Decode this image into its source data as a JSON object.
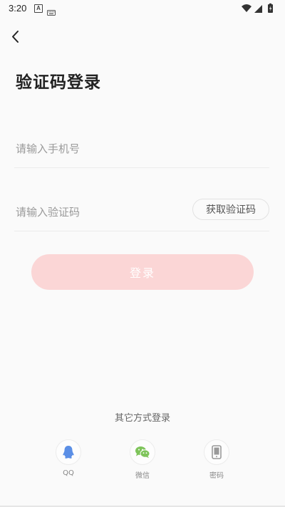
{
  "status_bar": {
    "time": "3:20",
    "icons": [
      "a-icon",
      "keyboard-icon",
      "wifi-icon",
      "signal-icon",
      "battery-icon"
    ]
  },
  "header": {
    "back_icon": "chevron-left-icon",
    "title": "验证码登录"
  },
  "form": {
    "phone_placeholder": "请输入手机号",
    "phone_value": "",
    "code_placeholder": "请输入验证码",
    "code_value": "",
    "get_code_label": "获取验证码",
    "login_label": "登录"
  },
  "alt_login": {
    "title": "其它方式登录",
    "options": [
      {
        "label": "QQ",
        "icon": "qq-icon",
        "color": "#5b8fe6"
      },
      {
        "label": "微信",
        "icon": "wechat-icon",
        "color": "#7ec45a"
      },
      {
        "label": "密码",
        "icon": "phone-icon",
        "color": "#9a9a9a"
      }
    ]
  },
  "colors": {
    "accent": "#fbd6d6",
    "background": "#fafafa"
  }
}
